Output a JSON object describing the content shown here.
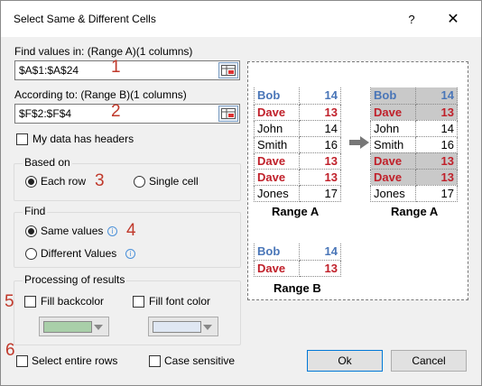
{
  "dialog": {
    "title": "Select Same & Different Cells",
    "help_label": "?",
    "close_label": "✕"
  },
  "find_values": {
    "label": "Find values in: (Range A)(1 columns)",
    "value": "$A$1:$A$24",
    "badge": "1"
  },
  "according_to": {
    "label": "According to: (Range B)(1 columns)",
    "value": "$F$2:$F$4",
    "badge": "2"
  },
  "headers_checkbox": {
    "label": "My data has headers"
  },
  "based_on": {
    "title": "Based on",
    "each_row": "Each row",
    "single_cell": "Single cell",
    "badge": "3",
    "selected": "each_row"
  },
  "find": {
    "title": "Find",
    "same_values": "Same values",
    "different_values": "Different Values",
    "badge": "4",
    "selected": "same_values"
  },
  "processing": {
    "title": "Processing of results",
    "fill_backcolor": "Fill backcolor",
    "fill_font_color": "Fill font color",
    "badge": "5",
    "backcolor_swatch": "#a9cfa9",
    "fontcolor_swatch": "#dfe7f3"
  },
  "bottom": {
    "select_rows": "Select entire rows",
    "case_sensitive": "Case sensitive",
    "badge": "6",
    "ok": "Ok",
    "cancel": "Cancel"
  },
  "preview": {
    "range_a_caption": "Range A",
    "range_a_result_caption": "Range A",
    "range_b_caption": "Range B",
    "range_a": [
      {
        "name": "Bob",
        "num": "14",
        "style": "blue"
      },
      {
        "name": "Dave",
        "num": "13",
        "style": "red"
      },
      {
        "name": "John",
        "num": "14",
        "style": "plain"
      },
      {
        "name": "Smith",
        "num": "16",
        "style": "plain"
      },
      {
        "name": "Dave",
        "num": "13",
        "style": "red"
      },
      {
        "name": "Dave",
        "num": "13",
        "style": "red"
      },
      {
        "name": "Jones",
        "num": "17",
        "style": "plain"
      }
    ],
    "range_a_result": [
      {
        "name": "Bob",
        "num": "14",
        "style": "blue hl"
      },
      {
        "name": "Dave",
        "num": "13",
        "style": "red hl"
      },
      {
        "name": "John",
        "num": "14",
        "style": "plain"
      },
      {
        "name": "Smith",
        "num": "16",
        "style": "plain"
      },
      {
        "name": "Dave",
        "num": "13",
        "style": "red hl"
      },
      {
        "name": "Dave",
        "num": "13",
        "style": "red hl"
      },
      {
        "name": "Jones",
        "num": "17",
        "style": "plain"
      }
    ],
    "range_b": [
      {
        "name": "Bob",
        "num": "14",
        "style": "blue"
      },
      {
        "name": "Dave",
        "num": "13",
        "style": "red"
      }
    ]
  }
}
